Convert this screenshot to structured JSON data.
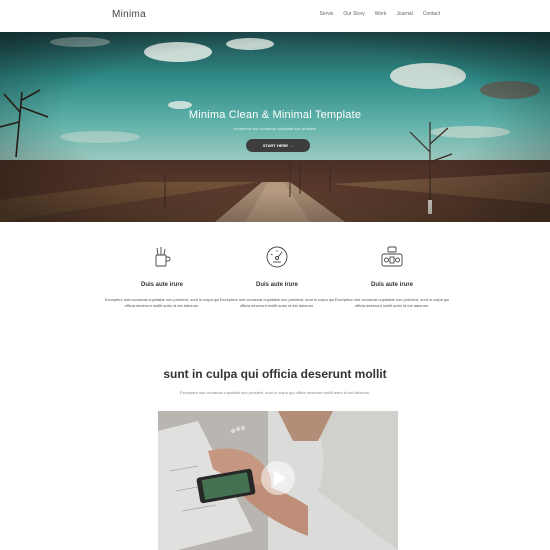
{
  "brand": {
    "name": "Minima"
  },
  "nav": {
    "items": [
      "Servis",
      "Our Story",
      "Work",
      "Journal",
      "Contact"
    ]
  },
  "hero": {
    "title": "Minima Clean & Minimal Template",
    "subtitle": "excepteur sint occaecat cupidatat non proident",
    "button_label": "START HERE →"
  },
  "features": [
    {
      "icon": "pencil-cup-icon",
      "title": "Duis aute irure",
      "text": "Excepteur sint occaecat cupidatat non proident, sunt in culpa qui officia deserunt mollit anim id est laborum."
    },
    {
      "icon": "gauge-icon",
      "title": "Duis aute irure",
      "text": "Excepteur sint occaecat cupidatat non proident, sunt in culpa qui officia deserunt mollit anim id est laborum."
    },
    {
      "icon": "machine-icon",
      "title": "Duis aute irure",
      "text": "Excepteur sint occaecat cupidatat non proident, sunt in culpa qui officia deserunt mollit anim id est laborum."
    }
  ],
  "section": {
    "title": "sunt in culpa qui officia deserunt mollit",
    "subtitle": "Excepteur sint occaecat cupidatat non proident, sunt in culpa qui officia deserunt mollit anim id est laborum."
  },
  "video": {
    "play_icon": "play-icon"
  }
}
